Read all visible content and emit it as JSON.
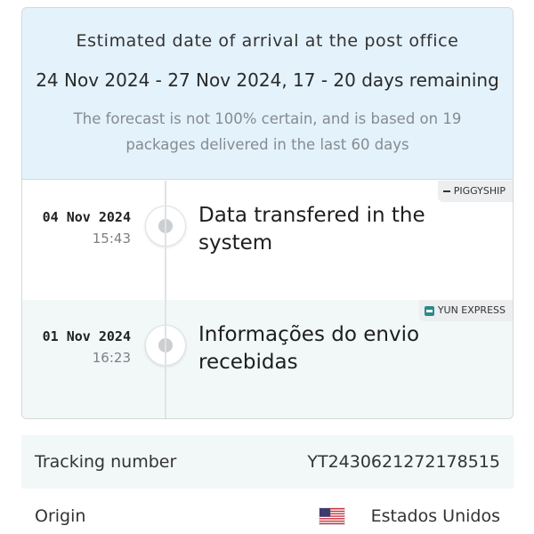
{
  "forecast": {
    "title": "Estimated date of arrival at the post office",
    "range": "24 Nov 2024 - 27 Nov 2024, 17 - 20 days remaining",
    "note": "The forecast is not 100% certain, and is based on 19 packages delivered in the last 60 days"
  },
  "events": [
    {
      "date": "04 Nov 2024",
      "time": "15:43",
      "description": "Data transfered in the system",
      "carrier": "PIGGYSHIP",
      "carrier_icon": "dash-icon"
    },
    {
      "date": "01 Nov 2024",
      "time": "16:23",
      "description": "Informações do envio recebidas",
      "carrier": "YUN EXPRESS",
      "carrier_icon": "yun-express-logo-icon"
    }
  ],
  "details": {
    "tracking_label": "Tracking number",
    "tracking_value": "YT2430621272178515",
    "origin_label": "Origin",
    "origin_value": "Estados Unidos",
    "origin_flag_icon": "us-flag-icon"
  },
  "colors": {
    "forecast_bg": "#e4f2fb",
    "alt_row_bg": "#f2f8f8",
    "carrier_teal": "#2a8a8c"
  }
}
